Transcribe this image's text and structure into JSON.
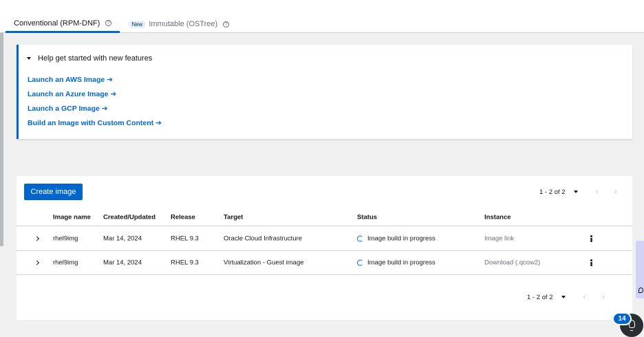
{
  "tabs": [
    {
      "label": "Conventional (RPM-DNF)",
      "badge": "",
      "active": true
    },
    {
      "label": "Immutable (OSTree)",
      "badge": "New",
      "active": false
    }
  ],
  "help": {
    "toggle_label": "Help get started with new features",
    "links": [
      "Launch an AWS Image ➔",
      "Launch an Azure Image ➔",
      "Launch a GCP Image ➔",
      "Build an Image with Custom Content ➔"
    ]
  },
  "toolbar": {
    "create_label": "Create image",
    "pagination": "1 - 2 of 2",
    "prev": "‹",
    "next": "›"
  },
  "table": {
    "columns": [
      "Image name",
      "Created/Updated",
      "Release",
      "Target",
      "Status",
      "Instance"
    ],
    "rows": [
      {
        "name": "rhel9img",
        "created": "Mar 14, 2024",
        "release": "RHEL 9.3",
        "target": "Oracle Cloud Infrastructure",
        "status": "Image build in progress",
        "instance": "Image link"
      },
      {
        "name": "rhel9img",
        "created": "Mar 14, 2024",
        "release": "RHEL 9.3",
        "target": "Virtualization - Guest image",
        "status": "Image build in progress",
        "instance": "Download (.qcow2)"
      }
    ]
  },
  "footer": {
    "pagination": "1 - 2 of 2",
    "prev": "‹",
    "next": "›"
  },
  "fab": {
    "count": "14"
  },
  "colors": {
    "accent": "#0066cc",
    "border": "#d2d2d2",
    "muted": "#6a6e73"
  }
}
